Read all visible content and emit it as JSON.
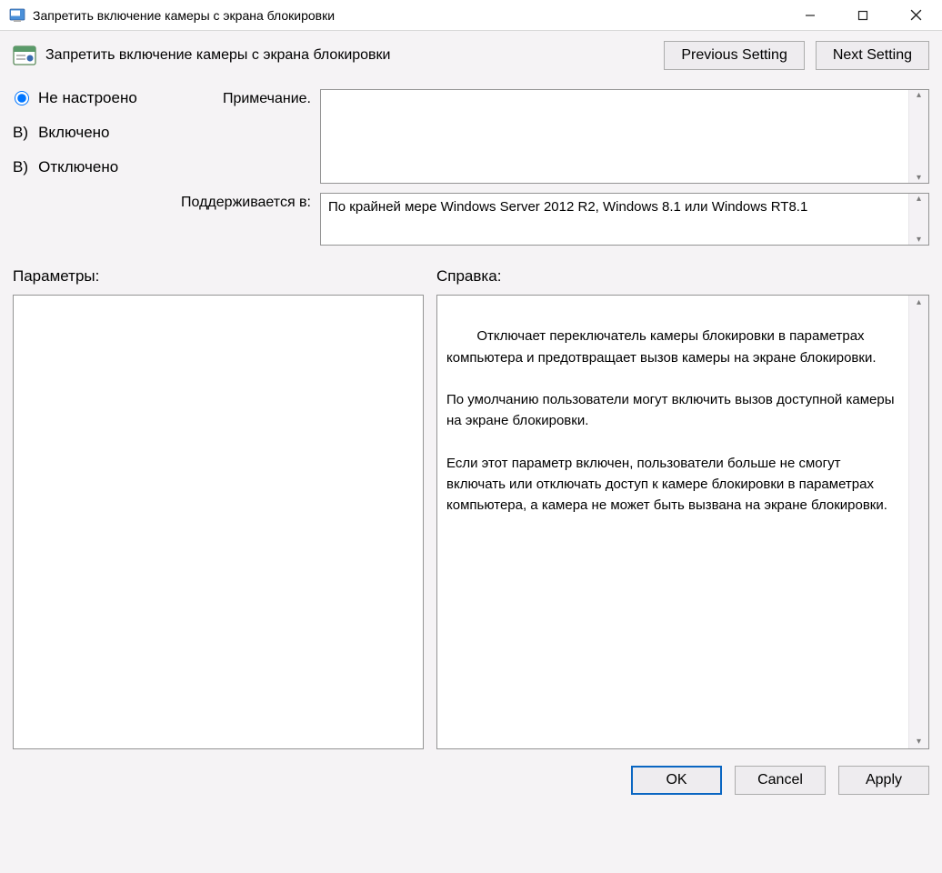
{
  "titlebar": {
    "title": "Запретить включение камеры с экрана блокировки"
  },
  "toolbar": {
    "label": "Запретить включение камеры с экрана блокировки",
    "prev_btn": "Previous Setting",
    "next_btn": "Next Setting"
  },
  "radios": {
    "not_configured": "Не настроено",
    "enabled_prefix": "В)",
    "enabled": "Включено",
    "disabled_prefix": "В)",
    "disabled": "Отключено"
  },
  "fields": {
    "comment_label": "Примечание.",
    "comment_value": "",
    "supported_label": "Поддерживается в:",
    "supported_value": "По крайней мере Windows Server 2012 R2, Windows 8.1 или Windows RT8.1"
  },
  "panels": {
    "params_label": "Параметры:",
    "help_label": "Справка:",
    "help_text": "Отключает переключатель камеры блокировки в параметрах компьютера и предотвращает вызов камеры на экране блокировки.\n\nПо умолчанию пользователи могут включить вызов доступной камеры на экране блокировки.\n\nЕсли этот параметр включен, пользователи больше не смогут включать или отключать доступ к камере блокировки в параметрах компьютера, а камера не может быть вызвана на экране блокировки."
  },
  "footer": {
    "ok": "OK",
    "cancel": "Cancel",
    "apply": "Apply"
  }
}
